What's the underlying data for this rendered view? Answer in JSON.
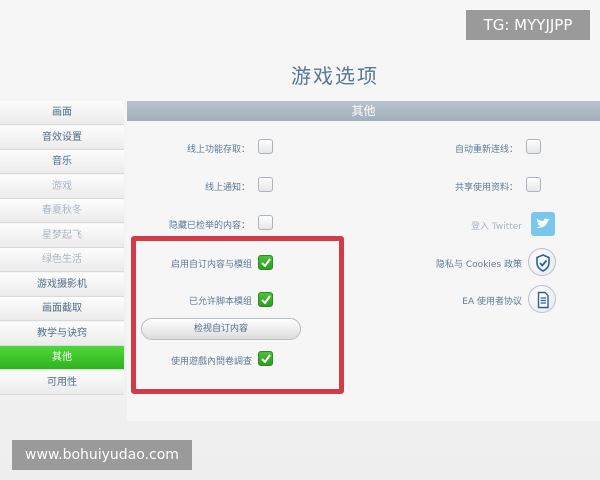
{
  "tg_badge": "TG: MYYJJPP",
  "page_title": "游戏选项",
  "sidebar": {
    "items": [
      {
        "label": "画面",
        "state": "normal"
      },
      {
        "label": "音效设置",
        "state": "normal"
      },
      {
        "label": "音乐",
        "state": "normal"
      },
      {
        "label": "游戏",
        "state": "dim"
      },
      {
        "label": "春夏秋冬",
        "state": "dim"
      },
      {
        "label": "星梦起飞",
        "state": "dim"
      },
      {
        "label": "绿色生活",
        "state": "dim"
      },
      {
        "label": "游戏摄影机",
        "state": "normal"
      },
      {
        "label": "画面截取",
        "state": "normal"
      },
      {
        "label": "教学与诀窍",
        "state": "normal"
      },
      {
        "label": "其他",
        "state": "active"
      },
      {
        "label": "可用性",
        "state": "normal"
      }
    ]
  },
  "panel": {
    "header": "其他",
    "left_options": [
      {
        "label": "线上功能存取：",
        "checked": false
      },
      {
        "label": "线上通知：",
        "checked": false
      },
      {
        "label": "隐藏已检举的内容：",
        "checked": false
      },
      {
        "label": "启用自订内容与模组",
        "checked": true
      },
      {
        "label": "已允许脚本模组",
        "checked": true
      },
      {
        "label": "使用遊戲內問卷調查",
        "checked": true
      }
    ],
    "check_custom_content_button": "检视自订内容",
    "right_options": [
      {
        "label": "自动重新连线：",
        "checked": false
      },
      {
        "label": "共享使用资料：",
        "checked": false
      }
    ],
    "right_links": [
      {
        "label": "登入 Twitter",
        "icon": "twitter-icon"
      },
      {
        "label": "隐私与 Cookies 政策",
        "icon": "privacy-shield-icon"
      },
      {
        "label": "EA 使用者协议",
        "icon": "document-icon"
      }
    ]
  },
  "url_badge": "www.bohuiyudao.com",
  "colors": {
    "active_tab": "#2fb21e",
    "header_bar": "#a9b5c1",
    "highlight_box": "#d23a47",
    "checkbox_checked": "#3aa82c"
  }
}
